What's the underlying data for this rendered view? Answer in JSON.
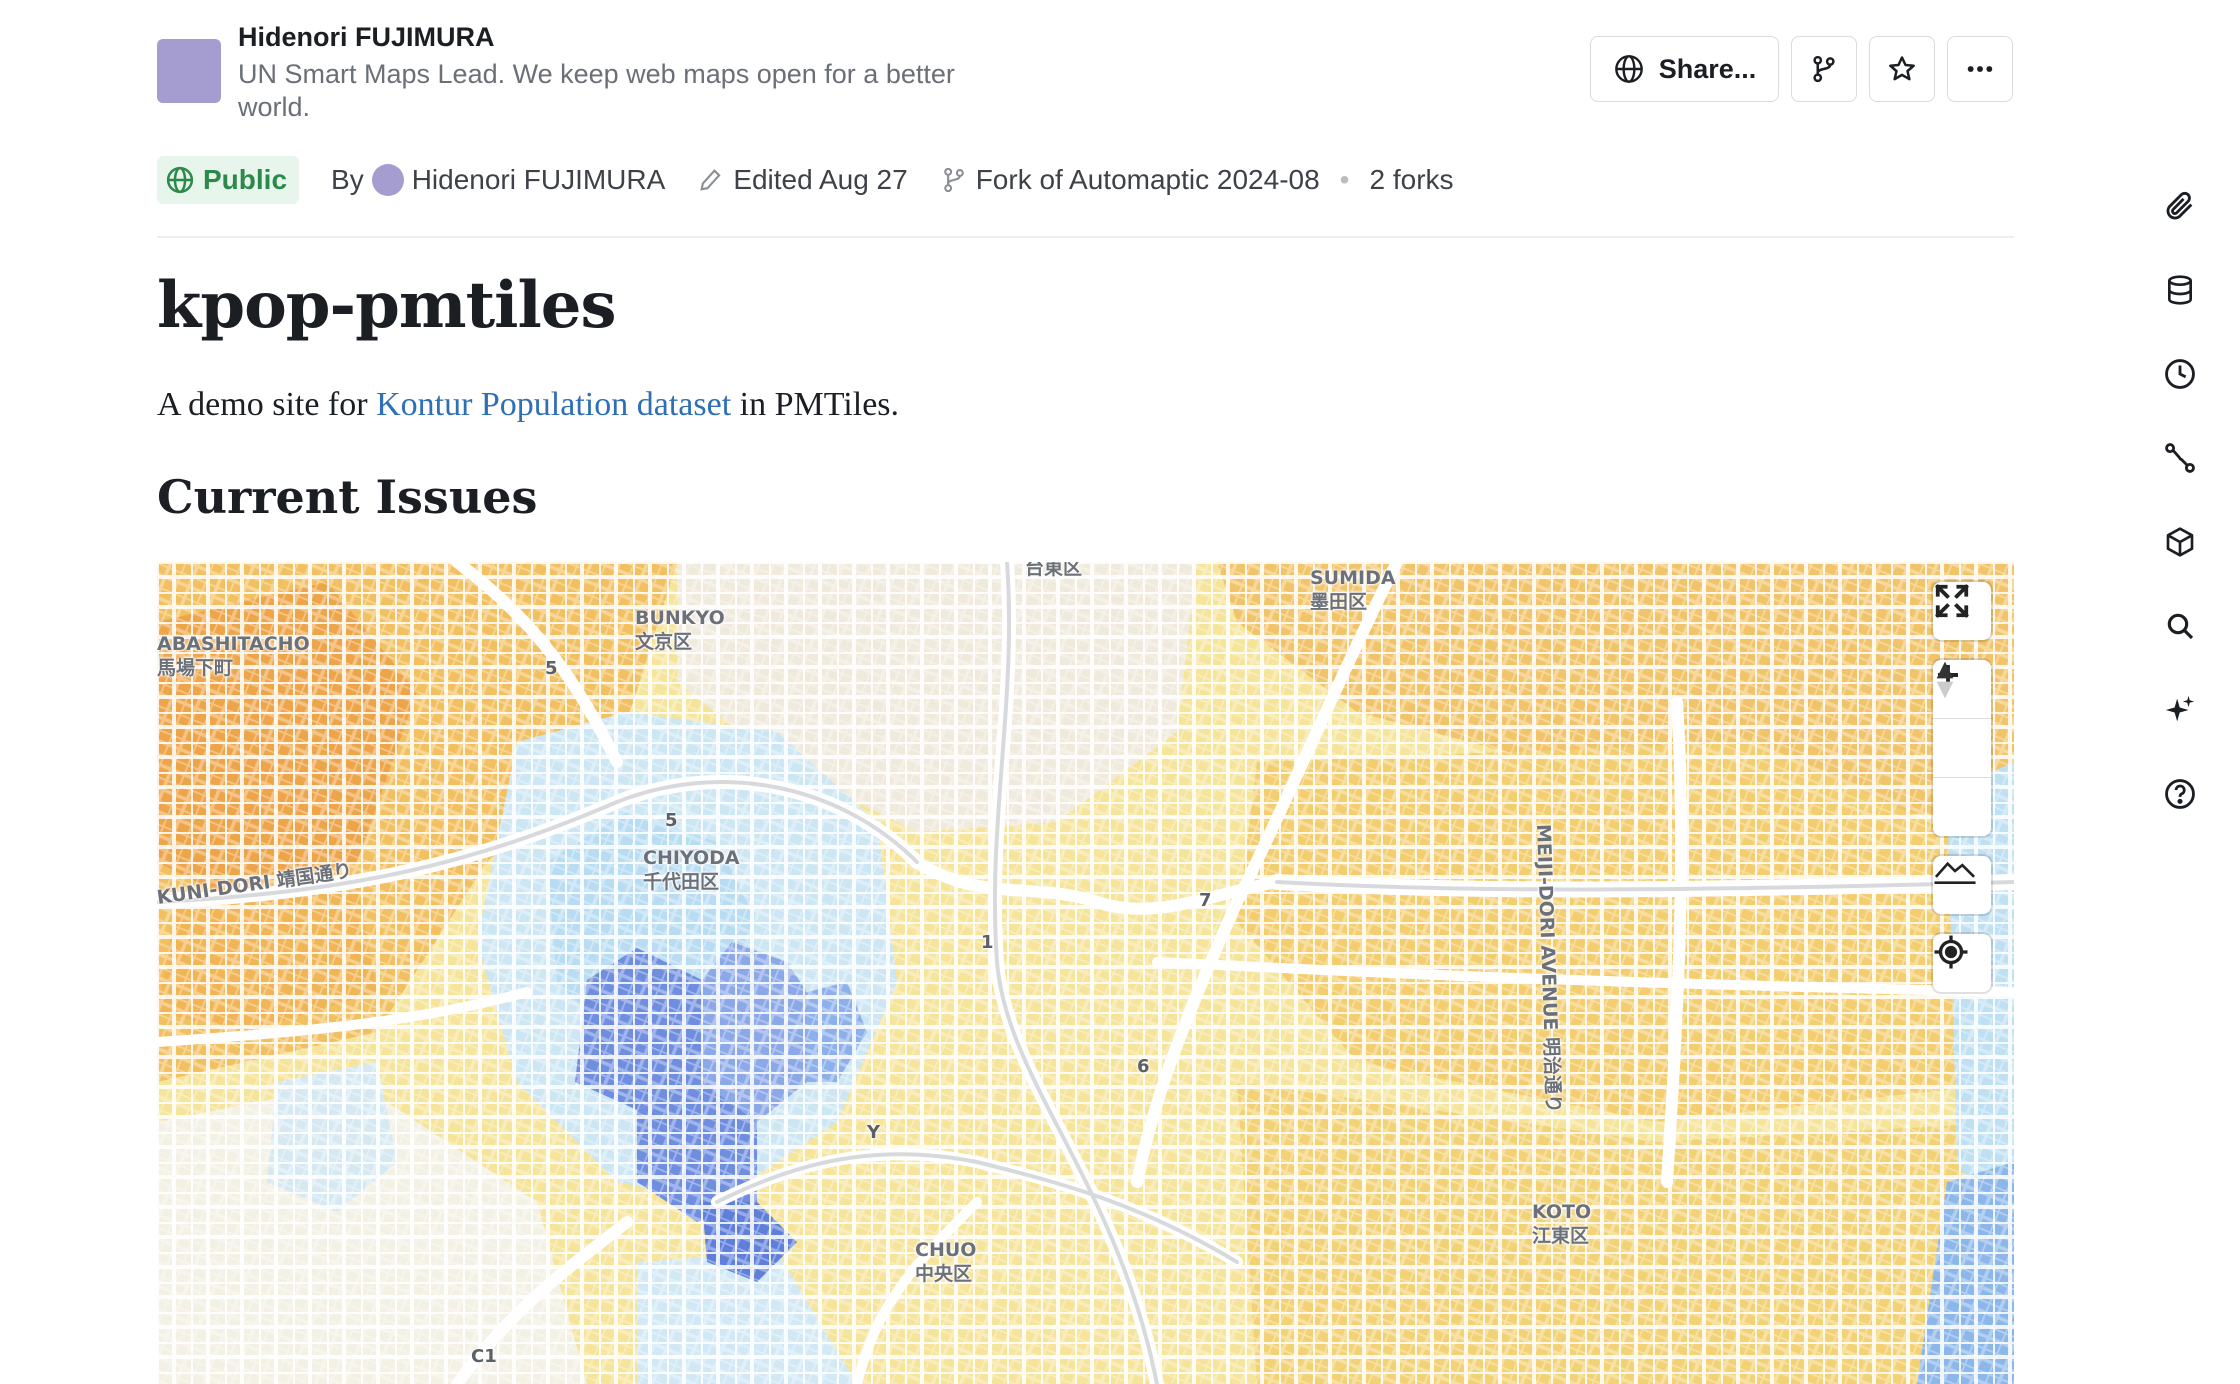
{
  "author": {
    "name": "Hidenori FUJIMURA",
    "bio": "UN Smart Maps Lead. We keep web maps open for a better world.",
    "avatar_color": "#a59ccf"
  },
  "header_actions": {
    "share_label": "Share...",
    "fork_icon": "fork-icon",
    "star_icon": "star-icon",
    "more_icon": "more-icon"
  },
  "meta": {
    "visibility": "Public",
    "by_label": "By",
    "by_name": "Hidenori FUJIMURA",
    "edited": "Edited Aug 27",
    "fork_of": "Fork of Automaptic 2024-08",
    "forks": "2 forks"
  },
  "page": {
    "title": "kpop-pmtiles",
    "intro_before": "A demo site for",
    "intro_link": "Kontur Population dataset",
    "intro_after": "in PMTiles.",
    "section_title": "Current Issues"
  },
  "map": {
    "labels": [
      {
        "id": "taito",
        "text": "台東区"
      },
      {
        "id": "sumida",
        "text": "SUMIDA\n墨田区"
      },
      {
        "id": "bunkyo",
        "text": "BUNKYO\n文京区"
      },
      {
        "id": "abashitacho",
        "text": "ABASHITACHO\n馬場下町"
      },
      {
        "id": "chiyoda",
        "text": "CHIYODA\n千代田区"
      },
      {
        "id": "chuo",
        "text": "CHUO\n中央区"
      },
      {
        "id": "koto",
        "text": "KOTO\n江東区"
      },
      {
        "id": "kunidori",
        "text": "KUNI-DORI 靖国通り"
      },
      {
        "id": "meiji",
        "text": "MEIJI-DORI AVENUE 明治通り"
      }
    ],
    "route_numbers": [
      "5",
      "5",
      "1",
      "7",
      "6",
      "Y",
      "C1"
    ],
    "controls": [
      "fullscreen-icon",
      "zoom-in-icon",
      "zoom-out-icon",
      "compass-icon",
      "terrain-icon",
      "geolocate-icon"
    ],
    "colors": {
      "water": "#bfe0f2",
      "population_low": "#f6e89a",
      "population_high": "#f0a848",
      "palace": "#6f8ee0"
    }
  },
  "right_rail": [
    "paperclip-icon",
    "database-icon",
    "history-icon",
    "connections-icon",
    "cube-icon",
    "search-icon",
    "sparkle-icon",
    "help-icon"
  ]
}
